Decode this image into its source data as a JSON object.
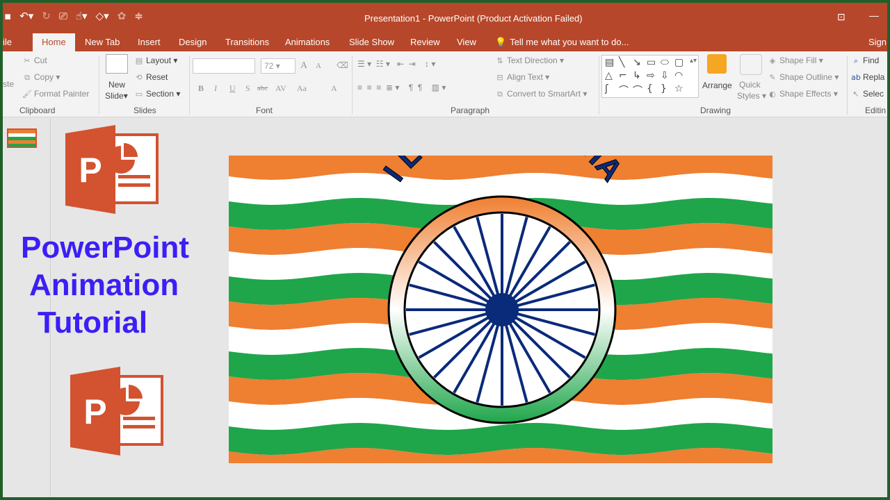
{
  "window": {
    "title": "Presentation1 - PowerPoint (Product Activation Failed)",
    "file_tab_partial": "ile",
    "help_partial": "Sign"
  },
  "tabs": [
    "Home",
    "New Tab",
    "Insert",
    "Design",
    "Transitions",
    "Animations",
    "Slide Show",
    "Review",
    "View"
  ],
  "tell_me": "Tell me what you want to do...",
  "clipboard": {
    "paste_partial": "ste",
    "cut": "Cut",
    "copy": "Copy",
    "format_painter": "Format Painter",
    "label": "Clipboard"
  },
  "slides": {
    "new_slide": "New",
    "new_slide_2": "Slide",
    "layout": "Layout",
    "reset": "Reset",
    "section": "Section",
    "label": "Slides"
  },
  "font": {
    "size": "72",
    "bold": "B",
    "italic": "I",
    "underline": "U",
    "shadow": "S",
    "strike": "abc",
    "spacing": "AV",
    "case": "Aa",
    "color": "A",
    "grow": "A",
    "shrink": "A",
    "label": "Font"
  },
  "paragraph": {
    "text_direction": "Text Direction",
    "align_text": "Align Text",
    "convert_smartart": "Convert to SmartArt",
    "label": "Paragraph"
  },
  "drawing": {
    "arrange": "Arrange",
    "quick": "Quick",
    "styles": "Styles",
    "shape_fill": "Shape Fill",
    "shape_outline": "Shape Outline",
    "shape_effects": "Shape Effects",
    "label": "Drawing"
  },
  "editing": {
    "find": "Find",
    "replace_partial": "Repla",
    "select_partial": "Selec",
    "label_partial": "Editin"
  },
  "overlay": {
    "line1": "PowerPoint",
    "line2": "Animation",
    "line3": "Tutorial",
    "logo_letter": "P"
  },
  "slide_content": {
    "arc_text": "I LOVE MY INDIA",
    "spokes": 24
  },
  "colors": {
    "saffron": "#ef7f31",
    "green": "#1fa64a",
    "navy": "#0a2a7a",
    "ppt_red": "#d35230",
    "tutorial_text": "#3b1ff5",
    "title_bar": "#b7472a"
  }
}
